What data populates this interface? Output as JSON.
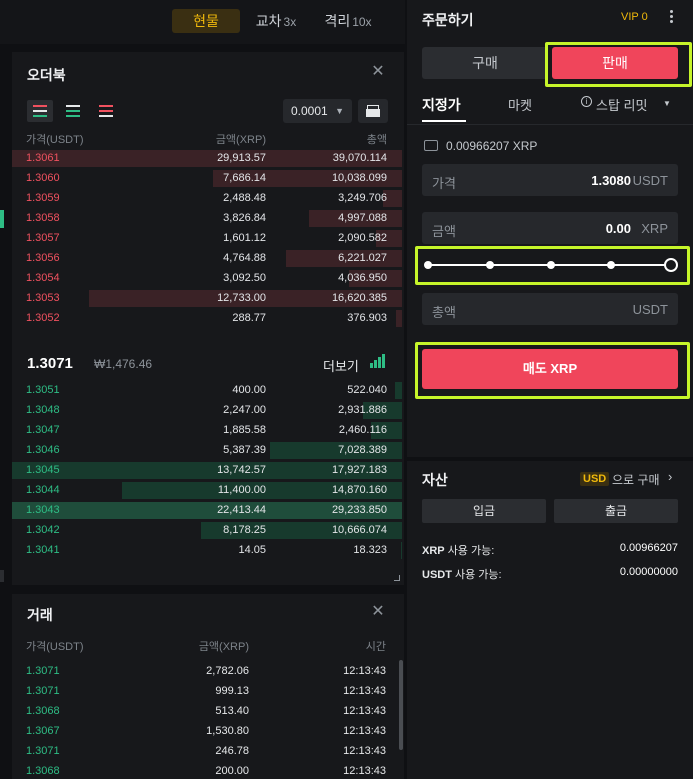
{
  "mode_tabs": [
    {
      "label": "현물",
      "suffix": ""
    },
    {
      "label": "교차",
      "suffix": "3x"
    },
    {
      "label": "격리",
      "suffix": "10x"
    }
  ],
  "orderbook": {
    "title": "오더북",
    "precision": "0.0001",
    "col_price": "가격(USDT)",
    "col_amount": "금액(XRP)",
    "col_total": "총액",
    "asks": [
      {
        "price": "1.3061",
        "amount": "29,913.57",
        "total": "39,070.114"
      },
      {
        "price": "1.3060",
        "amount": "7,686.14",
        "total": "10,038.099"
      },
      {
        "price": "1.3059",
        "amount": "2,488.48",
        "total": "3,249.706"
      },
      {
        "price": "1.3058",
        "amount": "3,826.84",
        "total": "4,997.088"
      },
      {
        "price": "1.3057",
        "amount": "1,601.12",
        "total": "2,090.582"
      },
      {
        "price": "1.3056",
        "amount": "4,764.88",
        "total": "6,221.027"
      },
      {
        "price": "1.3054",
        "amount": "3,092.50",
        "total": "4,036.950"
      },
      {
        "price": "1.3053",
        "amount": "12,733.00",
        "total": "16,620.385"
      },
      {
        "price": "1.3052",
        "amount": "288.77",
        "total": "376.903"
      }
    ],
    "last_price": "1.3071",
    "last_price_krw": "₩1,476.46",
    "more_label": "더보기",
    "bids": [
      {
        "price": "1.3051",
        "amount": "400.00",
        "total": "522.040"
      },
      {
        "price": "1.3048",
        "amount": "2,247.00",
        "total": "2,931.886"
      },
      {
        "price": "1.3047",
        "amount": "1,885.58",
        "total": "2,460.116"
      },
      {
        "price": "1.3046",
        "amount": "5,387.39",
        "total": "7,028.389"
      },
      {
        "price": "1.3045",
        "amount": "13,742.57",
        "total": "17,927.183"
      },
      {
        "price": "1.3044",
        "amount": "11,400.00",
        "total": "14,870.160"
      },
      {
        "price": "1.3043",
        "amount": "22,413.44",
        "total": "29,233.850"
      },
      {
        "price": "1.3042",
        "amount": "8,178.25",
        "total": "10,666.074"
      },
      {
        "price": "1.3041",
        "amount": "14.05",
        "total": "18.323"
      }
    ]
  },
  "trades": {
    "title": "거래",
    "col_price": "가격(USDT)",
    "col_amount": "금액(XRP)",
    "col_time": "시간",
    "rows": [
      {
        "price": "1.3071",
        "amount": "2,782.06",
        "time": "12:13:43"
      },
      {
        "price": "1.3071",
        "amount": "999.13",
        "time": "12:13:43"
      },
      {
        "price": "1.3068",
        "amount": "513.40",
        "time": "12:13:43"
      },
      {
        "price": "1.3067",
        "amount": "1,530.80",
        "time": "12:13:43"
      },
      {
        "price": "1.3071",
        "amount": "246.78",
        "time": "12:13:43"
      },
      {
        "price": "1.3068",
        "amount": "200.00",
        "time": "12:13:43"
      }
    ]
  },
  "order_form": {
    "title": "주문하기",
    "vip": "VIP 0",
    "buy_label": "구매",
    "sell_label": "판매",
    "type_tabs": [
      "지정가",
      "마켓",
      "스탑 리밋"
    ],
    "available": "0.00966207 XRP",
    "price_label": "가격",
    "price_value": "1.3080",
    "price_unit": "USDT",
    "amount_label": "금액",
    "amount_value": "0.00",
    "amount_unit": "XRP",
    "total_label": "총액",
    "total_unit": "USDT",
    "submit_label": "매도 XRP"
  },
  "assets": {
    "title": "자산",
    "currency_badge": "USD",
    "buy_link": "으로 구매",
    "deposit_label": "입금",
    "withdraw_label": "출금",
    "balances": [
      {
        "asset": "XRP",
        "label": "사용 가능:",
        "value": "0.00966207"
      },
      {
        "asset": "USDT",
        "label": "사용 가능:",
        "value": "0.00000000"
      }
    ]
  },
  "colors": {
    "ask": "#f0515f",
    "bid": "#2ebd85",
    "sell_button": "#f0455b",
    "accent": "#f0b90b",
    "highlight": "#c6f52a"
  }
}
